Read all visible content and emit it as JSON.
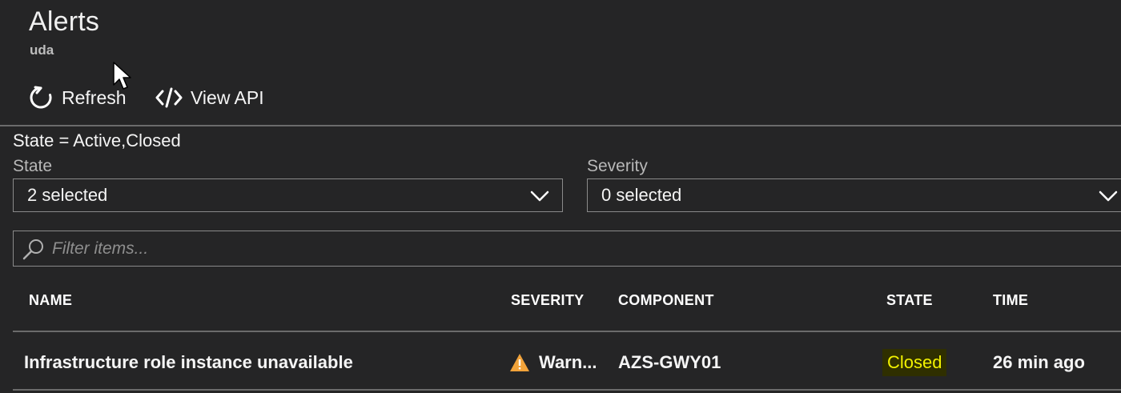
{
  "header": {
    "title": "Alerts",
    "subtitle": "uda"
  },
  "toolbar": {
    "refresh_label": "Refresh",
    "view_api_label": "View API"
  },
  "filter_summary": "State = Active,Closed",
  "filters": {
    "state": {
      "label": "State",
      "value": "2 selected"
    },
    "severity": {
      "label": "Severity",
      "value": "0 selected"
    }
  },
  "search": {
    "placeholder": "Filter items..."
  },
  "table": {
    "columns": [
      "NAME",
      "SEVERITY",
      "COMPONENT",
      "STATE",
      "TIME"
    ],
    "rows": [
      {
        "name": "Infrastructure role instance unavailable",
        "severity": "Warn...",
        "component": "AZS-GWY01",
        "state": "Closed",
        "time": "26 min ago"
      }
    ]
  },
  "colors": {
    "background": "#252526",
    "warning_icon": "#f2a33a",
    "state_closed_text": "#f2f200",
    "state_closed_bg": "#2f2f00"
  },
  "icons": {
    "refresh": "refresh-icon",
    "view_api": "code-icon",
    "dropdown": "chevron-down-icon",
    "search": "search-icon",
    "severity": "warning-icon",
    "cursor": "mouse-pointer-icon"
  }
}
